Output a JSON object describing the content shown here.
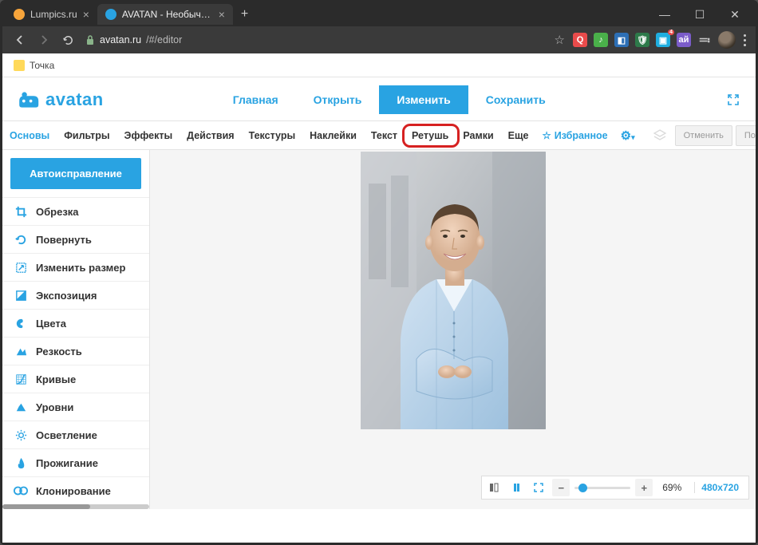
{
  "browser": {
    "tabs": [
      {
        "title": "Lumpics.ru",
        "favcolor": "#f7a53b"
      },
      {
        "title": "AVATAN - Необычный Фоторед...",
        "favcolor": "#29a3e2"
      }
    ],
    "url_host": "avatan.ru",
    "url_path": "/#/editor"
  },
  "bookmarks": {
    "item0": "Точка"
  },
  "logo": {
    "text": "avatan"
  },
  "mainnav": {
    "home": "Главная",
    "open": "Открыть",
    "edit": "Изменить",
    "save": "Сохранить"
  },
  "toolbar": {
    "items": [
      "Основы",
      "Фильтры",
      "Эффекты",
      "Действия",
      "Текстуры",
      "Наклейки",
      "Текст",
      "Ретушь",
      "Рамки",
      "Еще"
    ],
    "fav": "Избранное",
    "undo": "Отменить",
    "redo": "Повторить"
  },
  "sidebar": {
    "autofix": "Автоисправление",
    "items": [
      {
        "label": "Обрезка"
      },
      {
        "label": "Повернуть"
      },
      {
        "label": "Изменить размер"
      },
      {
        "label": "Экспозиция"
      },
      {
        "label": "Цвета"
      },
      {
        "label": "Резкость"
      },
      {
        "label": "Кривые"
      },
      {
        "label": "Уровни"
      },
      {
        "label": "Осветление"
      },
      {
        "label": "Прожигание"
      },
      {
        "label": "Клонирование"
      }
    ]
  },
  "status": {
    "zoom": "69%",
    "dims": "480x720"
  }
}
